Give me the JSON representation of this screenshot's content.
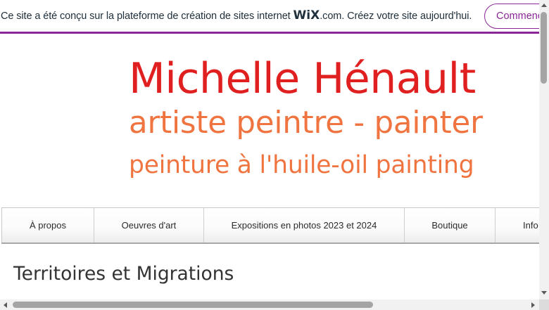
{
  "wix_banner": {
    "text_before_logo": "Ce site a été conçu sur la plateforme de création de sites internet ",
    "logo": "WiX",
    "text_after_logo": ".com. Créez votre site aujourd'hui.",
    "button_label": "Commencer",
    "accent_color": "#8a2796"
  },
  "header": {
    "title": "Michelle Hénault",
    "subtitle": "artiste peintre - painter",
    "tagline": "peinture à l'huile-oil painting",
    "title_color": "#e02020",
    "subtitle_color": "#f07440"
  },
  "nav": {
    "items": [
      {
        "label": "À propos"
      },
      {
        "label": "Oeuvres d'art"
      },
      {
        "label": "Expositions en photos 2023 et 2024"
      },
      {
        "label": "Boutique"
      },
      {
        "label": "Info"
      }
    ]
  },
  "main": {
    "section_title": "Territoires et Migrations"
  }
}
